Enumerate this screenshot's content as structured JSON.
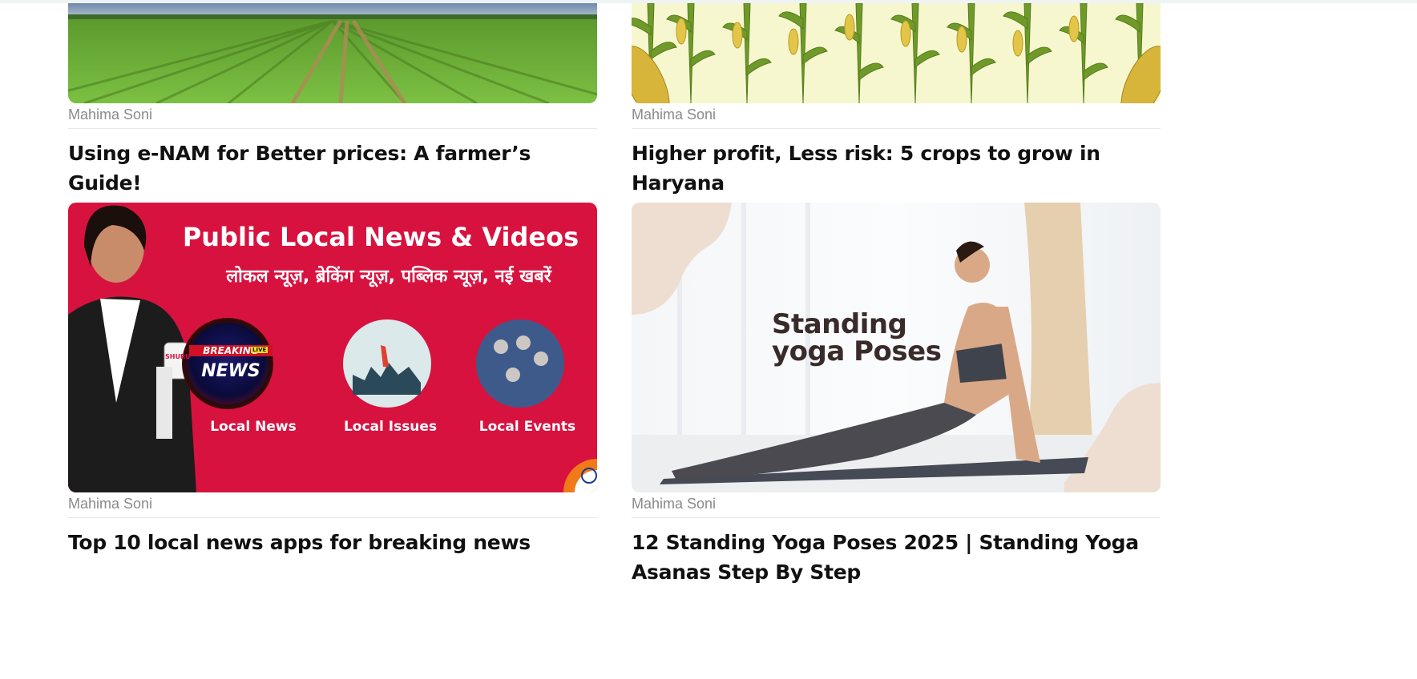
{
  "cards": [
    {
      "author": "Mahima Soni",
      "title": "Using e-NAM for Better prices: A farmer’s Guide!",
      "image": "crop-field-image"
    },
    {
      "author": "Mahima Soni",
      "title": "Higher profit, Less risk: 5 crops to grow in Haryana",
      "image": "corn-pattern-image"
    },
    {
      "author": "Mahima Soni",
      "title": "Top 10 local news apps for breaking news",
      "image": "local-news-banner-image",
      "banner": {
        "heading": "Public Local News & Videos",
        "hindi": "लोकल न्यूज़, ब्रेकिंग न्यूज़, पब्लिक न्यूज़, नई खबरें",
        "badge_small": "BREAKING",
        "badge_live": "LIVE",
        "badge_big": "NEWS",
        "mic_label": "SHURU",
        "labels": [
          "Local News",
          "Local Issues",
          "Local Events"
        ]
      }
    },
    {
      "author": "Mahima Soni",
      "title": "12 Standing Yoga Poses 2025 | Standing Yoga Asanas Step By Step",
      "image": "yoga-pose-image",
      "overlay": {
        "line1": "Standing",
        "line2": "yoga Poses"
      }
    }
  ],
  "colors": {
    "news_red": "#d8123f",
    "text": "#111111",
    "meta": "#8a8a8a",
    "divider": "#e8e8e8"
  }
}
